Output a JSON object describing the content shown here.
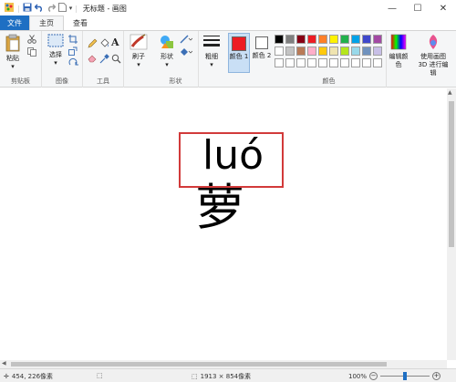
{
  "window": {
    "title": "无标题 - 画图"
  },
  "tabs": {
    "file": "文件",
    "home": "主页",
    "view": "查看"
  },
  "ribbon": {
    "clipboard": {
      "paste": "粘贴",
      "group": "剪贴板"
    },
    "image": {
      "select": "选择",
      "group": "图像"
    },
    "tools": {
      "group": "工具"
    },
    "brushes": {
      "label": "刷子"
    },
    "shapes": {
      "label": "形状",
      "group": "形状"
    },
    "outline": {
      "label": "粗细"
    },
    "color1": {
      "label": "颜色 1",
      "value": "#ed1c24"
    },
    "color2": {
      "label": "颜色 2",
      "value": "#ffffff"
    },
    "colors_group": "颜色",
    "edit_colors": "编辑颜色",
    "paint3d": "使用画图 3D 进行编辑",
    "palette_row1": [
      "#000000",
      "#7f7f7f",
      "#880015",
      "#ed1c24",
      "#ff7f27",
      "#fff200",
      "#22b14c",
      "#00a2e8",
      "#3f48cc",
      "#a349a4"
    ],
    "palette_row2": [
      "#ffffff",
      "#c3c3c3",
      "#b97a57",
      "#ffaec9",
      "#ffc90e",
      "#efe4b0",
      "#b5e61d",
      "#99d9ea",
      "#7092be",
      "#c8bfe7"
    ]
  },
  "canvas": {
    "pinyin": "luó",
    "hanzi": "萝"
  },
  "status": {
    "cursor": "454, 226像素",
    "dimensions": "1913 × 854像素",
    "zoom": "100%",
    "zoom_fraction": 0.5
  }
}
